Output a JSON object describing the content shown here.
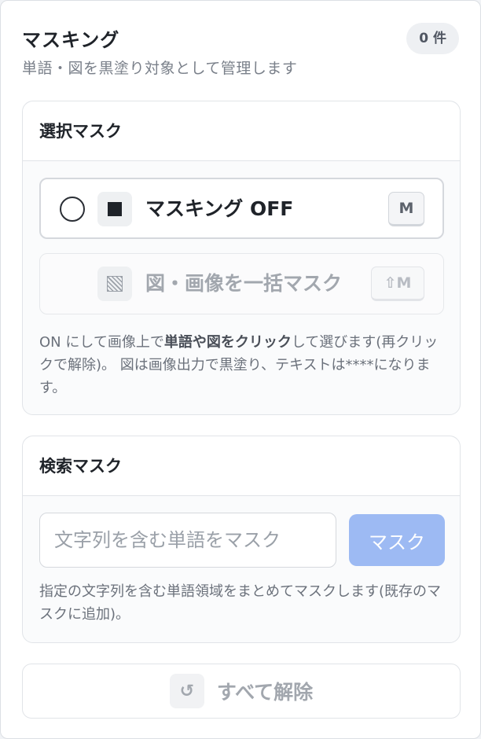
{
  "header": {
    "title": "マスキング",
    "subtitle": "単語・図を黒塗り対象として管理します",
    "count_badge": "0 件"
  },
  "select_mask": {
    "heading": "選択マスク",
    "toggle_option": {
      "label": "マスキング OFF",
      "shortcut": "M",
      "icon": "filled-square-icon",
      "state": "off"
    },
    "figures_option": {
      "label": "図・画像を一括マスク",
      "shortcut": "⇧M",
      "icon": "hatched-square-icon",
      "disabled": true
    },
    "description": {
      "part1": "ON にして画像上で",
      "bold": "単語や図をクリック",
      "part2": "して選びます(再クリックで解除)。 図は画像出力で黒塗り、テキストは****になります。"
    }
  },
  "search_mask": {
    "heading": "検索マスク",
    "input_value": "",
    "input_placeholder": "文字列を含む単語をマスク",
    "button_label": "マスク",
    "description": "指定の文字列を含む単語領域をまとめてマスクします(既存のマスクに追加)。"
  },
  "reset": {
    "label": "すべて解除",
    "icon_glyph": "↺"
  },
  "colors": {
    "accent_button": "#9dbaf3",
    "text_primary": "#1f2329",
    "text_muted": "#7a808a"
  }
}
